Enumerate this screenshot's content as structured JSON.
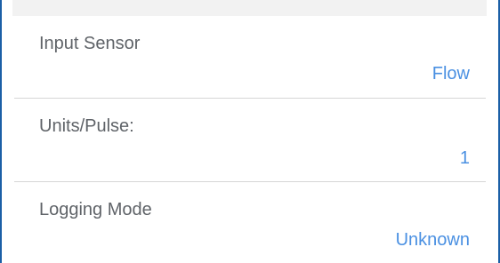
{
  "settings": {
    "input_sensor": {
      "label": "Input Sensor",
      "value": "Flow"
    },
    "units_per_pulse": {
      "label": "Units/Pulse:",
      "value": "1"
    },
    "logging_mode": {
      "label": "Logging Mode",
      "value": "Unknown"
    }
  },
  "colors": {
    "frame_border": "#1b5fa6",
    "value_text": "#4a90e2",
    "label_text": "#5f6368",
    "divider": "#d6d6d6"
  }
}
